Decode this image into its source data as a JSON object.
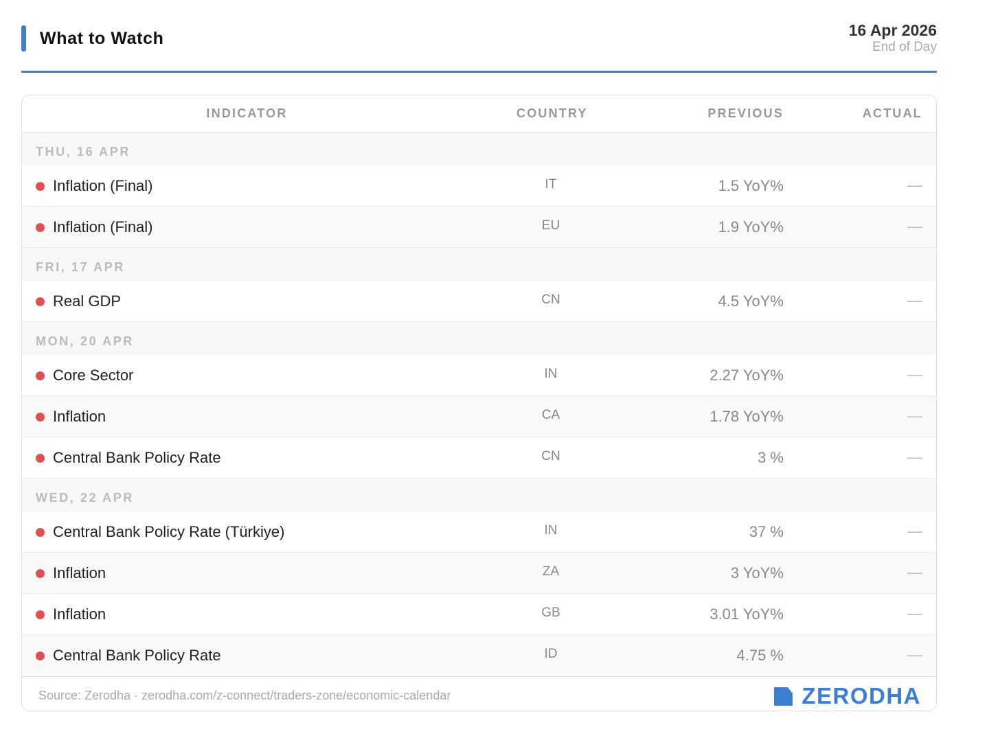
{
  "header": {
    "title": "What to Watch",
    "date": "16 Apr 2026",
    "date_sub": "End of Day",
    "accent_color": "#3b7fd4"
  },
  "table": {
    "columns": {
      "indicator": "INDICATOR",
      "country": "COUNTRY",
      "previous": "PREVIOUS",
      "actual": "ACTUAL"
    },
    "importance_dot_color": "#e05252",
    "days": [
      {
        "label": "THU, 16 APR",
        "rows": [
          {
            "indicator": "Inflation (Final)",
            "country": "IT",
            "previous": "1.5 YoY%",
            "actual": "—"
          },
          {
            "indicator": "Inflation (Final)",
            "country": "EU",
            "previous": "1.9 YoY%",
            "actual": "—"
          }
        ]
      },
      {
        "label": "FRI, 17 APR",
        "rows": [
          {
            "indicator": "Real GDP",
            "country": "CN",
            "previous": "4.5 YoY%",
            "actual": "—"
          }
        ]
      },
      {
        "label": "MON, 20 APR",
        "rows": [
          {
            "indicator": "Core Sector",
            "country": "IN",
            "previous": "2.27 YoY%",
            "actual": "—"
          },
          {
            "indicator": "Inflation",
            "country": "CA",
            "previous": "1.78 YoY%",
            "actual": "—"
          },
          {
            "indicator": "Central Bank Policy Rate",
            "country": "CN",
            "previous": "3 %",
            "actual": "—"
          }
        ]
      },
      {
        "label": "WED, 22 APR",
        "rows": [
          {
            "indicator": "Central Bank Policy Rate (Türkiye)",
            "country": "IN",
            "previous": "37 %",
            "actual": "—"
          },
          {
            "indicator": "Inflation",
            "country": "ZA",
            "previous": "3 YoY%",
            "actual": "—"
          },
          {
            "indicator": "Inflation",
            "country": "GB",
            "previous": "3.01 YoY%",
            "actual": "—"
          },
          {
            "indicator": "Central Bank Policy Rate",
            "country": "ID",
            "previous": "4.75 %",
            "actual": "—"
          }
        ]
      }
    ]
  },
  "footer": {
    "source": "Source: Zerodha",
    "separator": "·",
    "url": "zerodha.com/z-connect/traders-zone/economic-calendar",
    "brand": "ZERODHA",
    "brand_icon": "zerodha-logo-icon"
  }
}
